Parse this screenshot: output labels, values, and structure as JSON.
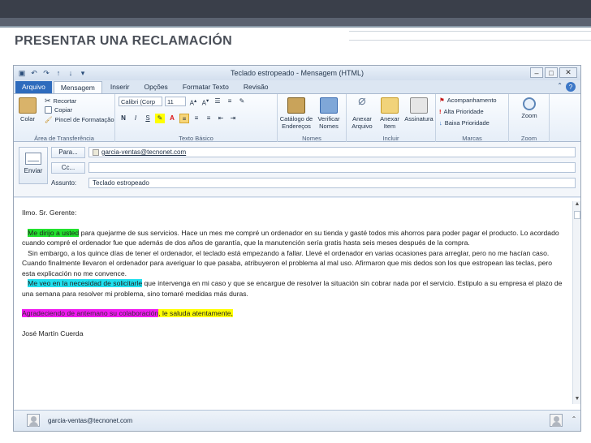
{
  "slide": {
    "title": "PRESENTAR UNA RECLAMACIÓN"
  },
  "window": {
    "title": "Teclado estropeado  -  Mensagem (HTML)"
  },
  "tabs": [
    {
      "label": "Arquivo"
    },
    {
      "label": "Mensagem"
    },
    {
      "label": "Inserir"
    },
    {
      "label": "Opções"
    },
    {
      "label": "Formatar Texto"
    },
    {
      "label": "Revisão"
    }
  ],
  "ribbon": {
    "clipboard": {
      "label": "Área de Transferência",
      "paste": "Colar",
      "cut": "Recortar",
      "copy": "Copiar",
      "painter": "Pincel de Formatação"
    },
    "basic_text": {
      "label": "Texto Básico",
      "font": "Calibri (Corp",
      "size": "11",
      "bold": "N",
      "italic": "I",
      "underline": "S"
    },
    "names": {
      "label": "Nomes",
      "address_book": "Catálogo de Endereços",
      "check_names": "Verificar Nomes"
    },
    "include": {
      "label": "Incluir",
      "attach_file": "Anexar Arquivo",
      "attach_item": "Anexar Item",
      "signature": "Assinatura"
    },
    "tags": {
      "label": "Marcas",
      "follow_up": "Acompanhamento",
      "high": "Alta Prioridade",
      "low": "Baixa Prioridade"
    },
    "zoom": {
      "label": "Zoom",
      "button": "Zoom"
    }
  },
  "header": {
    "send": "Enviar",
    "to_button": "Para...",
    "cc_button": "Cc...",
    "subject_label": "Assunto:",
    "to_value": "garcia-ventas@tecnonet.com",
    "cc_value": "",
    "subject_value": "Teclado estropeado"
  },
  "body": {
    "greeting": "Ilmo. Sr. Gerente:",
    "p1_highlight": "Me dirijo a usted",
    "p1_rest": " para quejarme de sus servicios. Hace un mes me compré un ordenador en su tienda y gasté todos mis ahorros para poder pagar el producto. Lo acordado cuando compré el ordenador fue que además de dos años de garantía, que la manutención sería gratis hasta seis meses después de la compra.",
    "p2": "Sin embargo, a los quince días de tener el ordenador, el teclado está empezando a fallar. Llevé el ordenador en varias ocasiones para arreglar, pero no me hacían caso. Cuando finalmente llevaron el ordenador para averiguar lo que pasaba, atribuyeron el problema al mal uso. Afirmaron que mis dedos son los que estropean las teclas, pero esta explicación no me convence.",
    "p3_highlight": "Me veo en la necesidad de solicitarle",
    "p3_rest": " que intervenga en mi caso y que se encargue de resolver la situación sin cobrar nada por el servicio. Estipulo a su empresa el plazo de una semana para resolver mi problema, sino tomaré medidas más duras.",
    "closing_magenta": "Agradeciendo de antemano su colaboración",
    "closing_yellow": ", le saluda atentamente,",
    "signature": "José Martín Cuerda"
  },
  "people_pane": {
    "email": "garcia-ventas@tecnonet.com"
  },
  "colors": {
    "file_tab": "#2e6bbd",
    "green": "#22e22e",
    "cyan": "#20e0ef",
    "magenta": "#f01af0",
    "yellow": "#ffff00"
  }
}
